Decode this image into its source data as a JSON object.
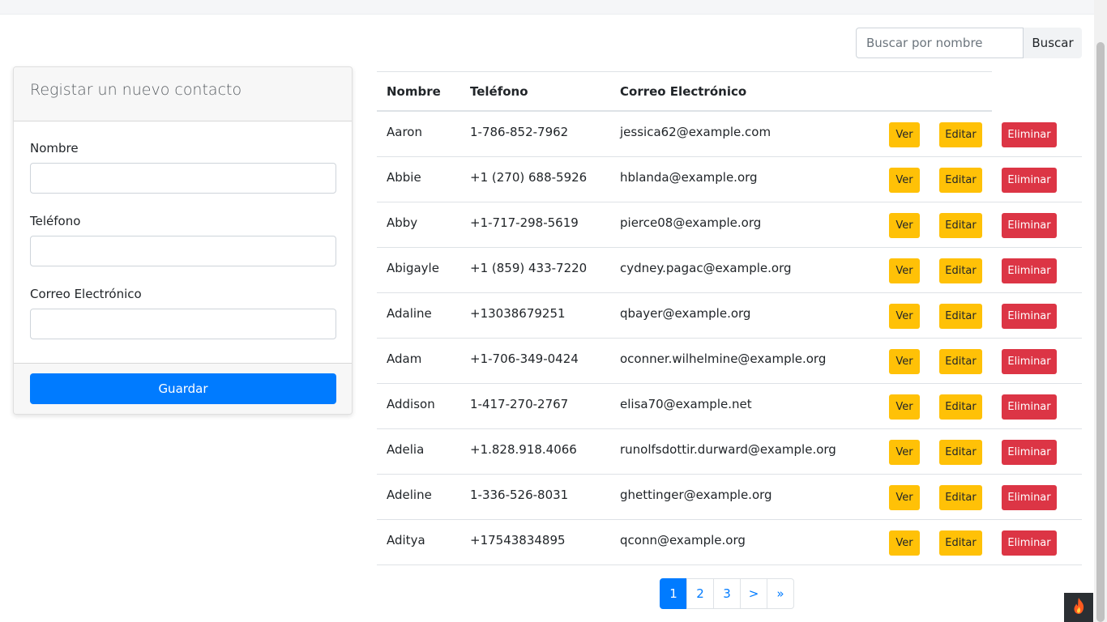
{
  "search": {
    "placeholder": "Buscar por nombre",
    "button_label": "Buscar"
  },
  "form": {
    "title": "Registar un nuevo contacto",
    "fields": [
      {
        "label": "Nombre"
      },
      {
        "label": "Teléfono"
      },
      {
        "label": "Correo Electrónico"
      }
    ],
    "save_label": "Guardar"
  },
  "table": {
    "headers": {
      "name": "Nombre",
      "phone": "Teléfono",
      "email": "Correo Electrónico"
    },
    "actions": {
      "view": "Ver",
      "edit": "Editar",
      "delete": "Eliminar"
    },
    "rows": [
      {
        "name": "Aaron",
        "phone": "1-786-852-7962",
        "email": "jessica62@example.com"
      },
      {
        "name": "Abbie",
        "phone": "+1 (270) 688-5926",
        "email": "hblanda@example.org"
      },
      {
        "name": "Abby",
        "phone": "+1-717-298-5619",
        "email": "pierce08@example.org"
      },
      {
        "name": "Abigayle",
        "phone": "+1 (859) 433-7220",
        "email": "cydney.pagac@example.org"
      },
      {
        "name": "Adaline",
        "phone": "+13038679251",
        "email": "qbayer@example.org"
      },
      {
        "name": "Adam",
        "phone": "+1-706-349-0424",
        "email": "oconner.wilhelmine@example.org"
      },
      {
        "name": "Addison",
        "phone": "1-417-270-2767",
        "email": "elisa70@example.net"
      },
      {
        "name": "Adelia",
        "phone": "+1.828.918.4066",
        "email": "runolfsdottir.durward@example.org"
      },
      {
        "name": "Adeline",
        "phone": "1-336-526-8031",
        "email": "ghettinger@example.org"
      },
      {
        "name": "Aditya",
        "phone": "+17543834895",
        "email": "qconn@example.org"
      }
    ]
  },
  "pagination": {
    "current_page": 1,
    "items": [
      "1",
      "2",
      "3",
      ">",
      "»"
    ]
  },
  "colors": {
    "primary": "#007bff",
    "warning": "#ffc107",
    "danger": "#dc3545",
    "corner_badge": "#2b2f33",
    "flame": "#ff5a1f"
  },
  "icons": {
    "corner_badge": "flame-icon"
  }
}
